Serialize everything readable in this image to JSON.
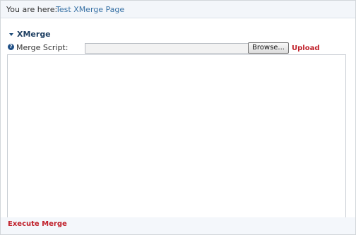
{
  "breadcrumb": {
    "label": "You are here:",
    "link": "Test XMerge Page"
  },
  "section": {
    "title": "XMerge",
    "icon": "chevron-down-icon"
  },
  "merge_script": {
    "label": "Merge Script:",
    "help_icon": "help-icon",
    "help_glyph": "?",
    "file_value": "",
    "browse_label": "Browse...",
    "upload_label": "Upload",
    "script_value": ""
  },
  "footer": {
    "execute_label": "Execute Merge"
  },
  "colors": {
    "link_blue": "#3a73a6",
    "action_red": "#c0202a",
    "header_navy": "#1e3f62",
    "breadcrumb_bg": "#f3f6fa"
  }
}
